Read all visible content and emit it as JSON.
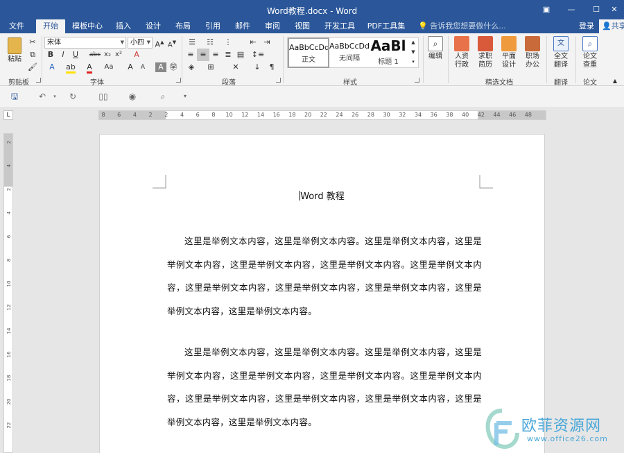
{
  "window": {
    "title": "Word教程.docx - Word",
    "buttons": [
      "restore-ribbon-icon",
      "minimize-icon",
      "maximize-icon",
      "close-icon"
    ]
  },
  "tabs": [
    {
      "label": "文件",
      "active": false
    },
    {
      "label": "开始",
      "active": true
    },
    {
      "label": "模板中心",
      "active": false
    },
    {
      "label": "插入",
      "active": false
    },
    {
      "label": "设计",
      "active": false
    },
    {
      "label": "布局",
      "active": false
    },
    {
      "label": "引用",
      "active": false
    },
    {
      "label": "邮件",
      "active": false
    },
    {
      "label": "审阅",
      "active": false
    },
    {
      "label": "视图",
      "active": false
    },
    {
      "label": "开发工具",
      "active": false
    },
    {
      "label": "PDF工具集",
      "active": false
    }
  ],
  "tellme": "告诉我您想要做什么...",
  "account": {
    "login": "登录",
    "share": "共享"
  },
  "ribbon": {
    "clipboard": {
      "paste": "粘贴",
      "group": "剪贴板"
    },
    "font": {
      "name": "宋体",
      "size": "小四",
      "group": "字体",
      "buttons": {
        "bold": "B",
        "italic": "I",
        "underline": "U",
        "strike": "abc",
        "sub": "x₂",
        "sup": "x²",
        "clear": "A",
        "case": "Aa"
      }
    },
    "paragraph": {
      "group": "段落"
    },
    "styles": {
      "group": "样式",
      "items": [
        {
          "sample": "AaBbCcDd",
          "name": "正文"
        },
        {
          "sample": "AaBbCcDd",
          "name": "无间隔"
        },
        {
          "sample": "AaBl",
          "name": "标题 1"
        }
      ]
    },
    "editing": {
      "label": "编辑"
    },
    "featured": {
      "group": "精选文档",
      "items": [
        {
          "label1": "人资",
          "label2": "行政"
        },
        {
          "label1": "求职",
          "label2": "简历"
        },
        {
          "label1": "平面",
          "label2": "设计"
        },
        {
          "label1": "职场",
          "label2": "办公"
        }
      ]
    },
    "translate": {
      "label1": "全文",
      "label2": "翻译",
      "group": "翻译"
    },
    "paper": {
      "label1": "论文",
      "label2": "查重",
      "group": "论文"
    }
  },
  "ruler": {
    "ticks": [
      "8",
      "6",
      "4",
      "2",
      "2",
      "4",
      "6",
      "8",
      "10",
      "12",
      "14",
      "16",
      "18",
      "20",
      "22",
      "24",
      "26",
      "28",
      "30",
      "32",
      "34",
      "36",
      "38",
      "40",
      "42",
      "44",
      "46",
      "48"
    ],
    "vticks": [
      "2",
      "4",
      "2",
      "4",
      "6",
      "8",
      "10",
      "12",
      "14",
      "16",
      "18",
      "20",
      "22"
    ]
  },
  "document": {
    "title": "Word 教程",
    "paragraphs": [
      "这里是举例文本内容，这里是举例文本内容。这里是举例文本内容，这里是举例文本内容，这里是举例文本内容，这里是举例文本内容。这里是举例文本内容，这里是举例文本内容，这里是举例文本内容，这里是举例文本内容，这里是举例文本内容，这里是举例文本内容。",
      "这里是举例文本内容，这里是举例文本内容。这里是举例文本内容，这里是举例文本内容，这里是举例文本内容，这里是举例文本内容。这里是举例文本内容，这里是举例文本内容，这里是举例文本内容，这里是举例文本内容，这里是举例文本内容，这里是举例文本内容。"
    ]
  },
  "watermark": {
    "text": "欧菲资源网",
    "url": "www.office26.com"
  }
}
